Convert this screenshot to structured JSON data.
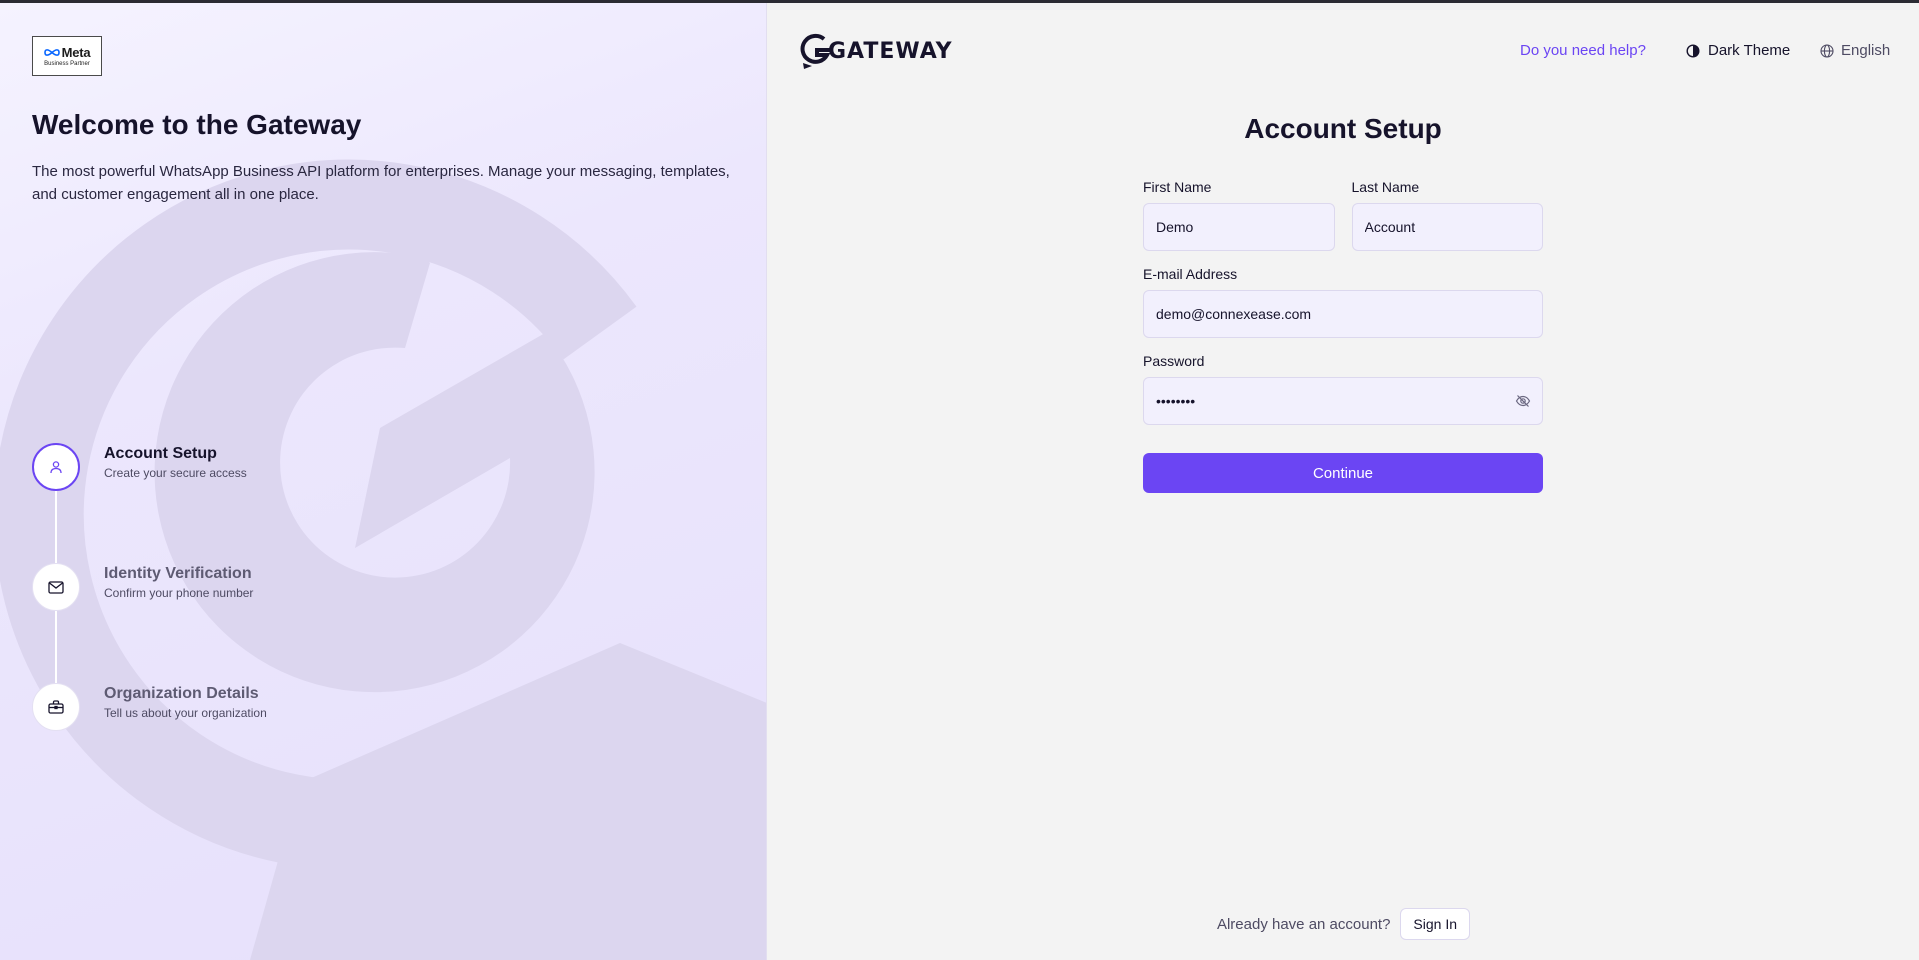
{
  "app": {
    "brand": "GATEWAY",
    "partner_badge": {
      "logo": "Meta",
      "subtitle": "Business Partner"
    },
    "accent_color": "#6b45f3"
  },
  "welcome": {
    "title": "Welcome to the Gateway",
    "description": "The most powerful WhatsApp Business API platform for enterprises. Manage your messaging, templates, and customer engagement all in one place."
  },
  "steps": [
    {
      "title": "Account Setup",
      "subtitle": "Create your secure access",
      "icon": "user-icon",
      "active": true
    },
    {
      "title": "Identity Verification",
      "subtitle": "Confirm your phone number",
      "icon": "mail-icon",
      "active": false
    },
    {
      "title": "Organization Details",
      "subtitle": "Tell us about your organization",
      "icon": "briefcase-icon",
      "active": false
    }
  ],
  "header": {
    "help_link": "Do you need help?",
    "theme_toggle": "Dark Theme",
    "language": "English"
  },
  "form": {
    "title": "Account Setup",
    "first_name": {
      "label": "First Name",
      "value": "Demo"
    },
    "last_name": {
      "label": "Last Name",
      "value": "Account"
    },
    "email": {
      "label": "E-mail Address",
      "value": "demo@connexease.com"
    },
    "password": {
      "label": "Password",
      "value": "demopass"
    },
    "continue_label": "Continue"
  },
  "footer": {
    "prompt": "Already have an account?",
    "signin_label": "Sign In"
  }
}
